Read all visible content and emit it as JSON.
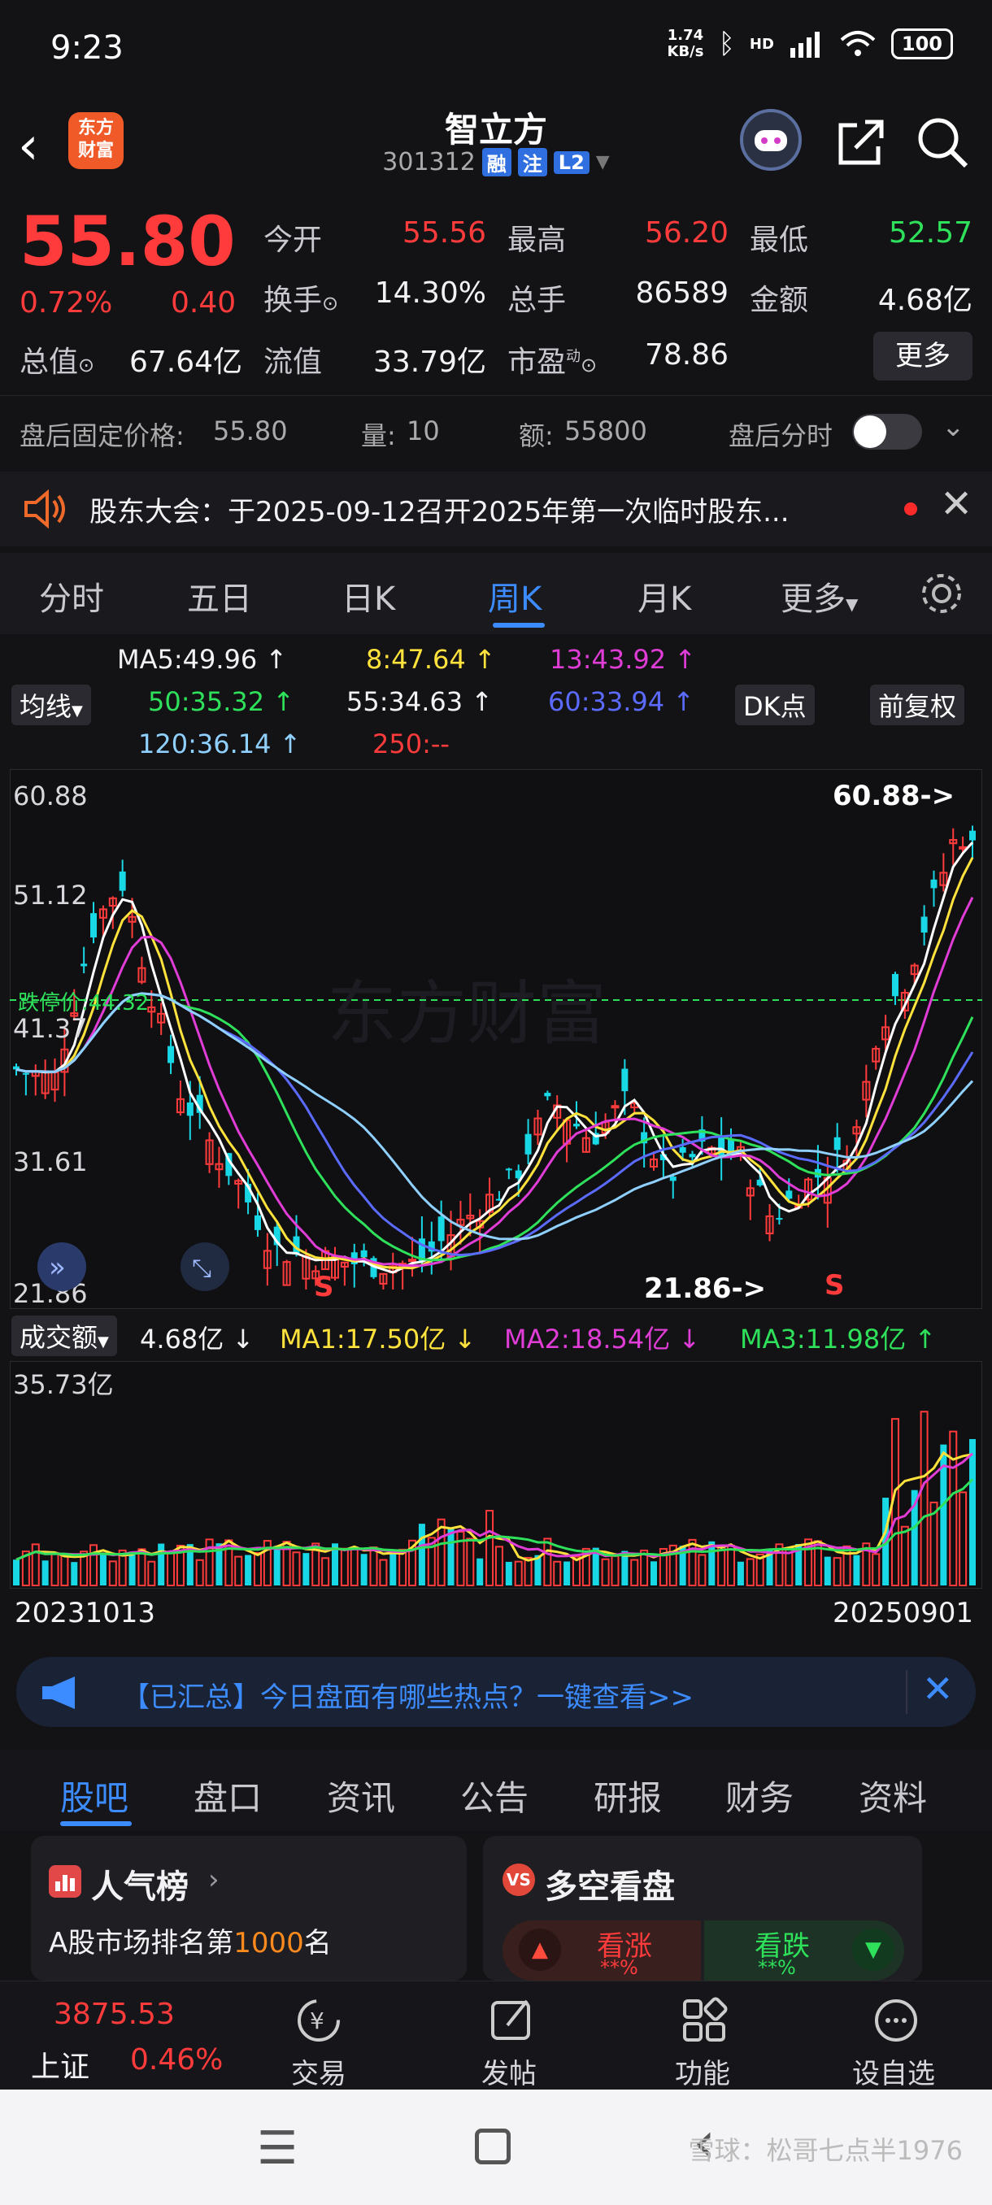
{
  "status_bar": {
    "time": "9:23",
    "net_speed_top": "1.74",
    "net_speed_bottom": "KB/s",
    "hd": "HD",
    "battery": "100"
  },
  "header": {
    "logo_line1": "东方",
    "logo_line2": "财富",
    "stock_name": "智立方",
    "stock_code": "301312",
    "tags": [
      "融",
      "注",
      "L2"
    ]
  },
  "quote": {
    "price": "55.80",
    "change_pct": "0.72%",
    "change_abs": "0.40",
    "open_label": "今开",
    "open": "55.56",
    "high_label": "最高",
    "high": "56.20",
    "low_label": "最低",
    "low": "52.57",
    "turnover_label": "换手",
    "turnover": "14.30%",
    "volume_label": "总手",
    "volume": "86589",
    "amount_label": "金额",
    "amount": "4.68亿",
    "mktcap_label": "总值",
    "mktcap": "67.64亿",
    "float_label": "流值",
    "float": "33.79亿",
    "pe_label": "市盈",
    "pe_sup": "动",
    "pe": "78.86",
    "more": "更多"
  },
  "after_hours": {
    "price_label": "盘后固定价格:",
    "price": "55.80",
    "vol_label": "量:",
    "vol": "10",
    "amt_label": "额:",
    "amt": "55800",
    "share_label": "盘后分时"
  },
  "announcement": {
    "text": "股东大会：于2025-09-12召开2025年第一次临时股东..."
  },
  "period_tabs": [
    "分时",
    "五日",
    "日K",
    "周K",
    "月K",
    "更多"
  ],
  "ma_legend": {
    "ma5": "MA5:49.96",
    "ma8": "8:47.64",
    "ma13": "13:43.92",
    "ma50": "50:35.32",
    "ma55": "55:34.63",
    "ma60": "60:33.94",
    "ma120": "120:36.14",
    "ma250": "250:--",
    "indicator": "均线",
    "dk": "DK点",
    "adjust": "前复权"
  },
  "kline": {
    "y_labels": [
      "60.88",
      "51.12",
      "41.37",
      "31.61",
      "21.86"
    ],
    "limit_label": "跌停价:44.32",
    "max_marker": "60.88->",
    "min_marker": "21.86->",
    "sell_marker": "S",
    "watermark": "东方财富"
  },
  "volume": {
    "indicator": "成交额",
    "value": "4.68亿",
    "ma1": "MA1:17.50亿",
    "ma2": "MA2:18.54亿",
    "ma3": "MA3:11.98亿",
    "y_max": "35.73亿"
  },
  "dates": {
    "start": "20231013",
    "end": "20250901"
  },
  "hot_banner": {
    "text": "【已汇总】今日盘面有哪些热点？一键查看>>"
  },
  "info_tabs": [
    "股吧",
    "盘口",
    "资讯",
    "公告",
    "研报",
    "财务",
    "资料"
  ],
  "cards": {
    "popularity_title": "人气榜",
    "popularity_text_pre": "A股市场排名第",
    "popularity_rank": "1000",
    "popularity_text_post": "名",
    "bullbear_title": "多空看盘",
    "bull": "看涨",
    "bear": "看跌",
    "bull_pct": "**%",
    "bear_pct": "**%"
  },
  "bottom_nav": {
    "index_value": "3875.53",
    "index_name": "上证",
    "index_pct": "0.46%",
    "items": [
      "交易",
      "发帖",
      "功能",
      "设自选"
    ]
  },
  "watermark": "雪球：松哥七点半1976",
  "colors": {
    "up": "#ff3b3b",
    "down": "#2ee05a",
    "accent": "#3d8cff",
    "cyan_candle": "#19d8e6"
  }
}
